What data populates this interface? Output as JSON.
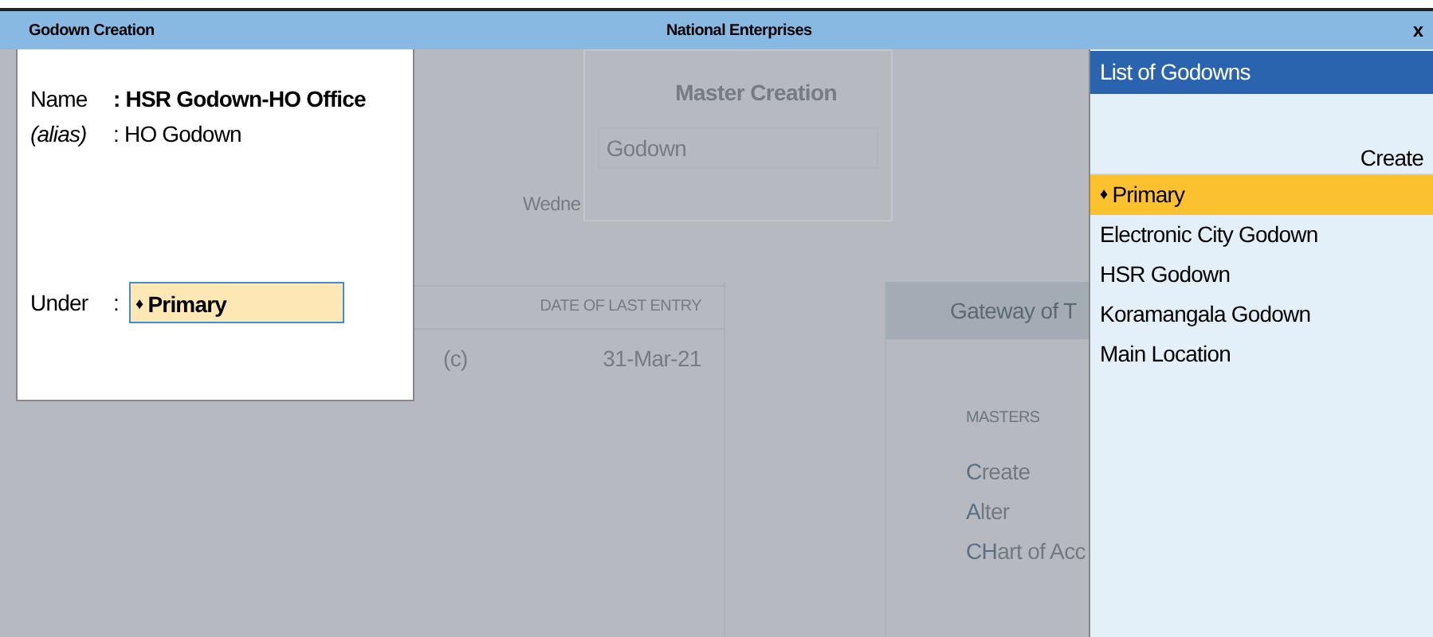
{
  "window": {
    "title": "Godown Creation",
    "company": "National Enterprises",
    "close": "x"
  },
  "form": {
    "separator": ":",
    "fields": [
      {
        "kind": "name",
        "label": "Name",
        "value": "HSR Godown-HO Office"
      },
      {
        "kind": "alias",
        "label": "(alias)",
        "value": "HO Godown"
      }
    ],
    "under": {
      "label": "Under",
      "marker": "♦",
      "value": "Primary"
    }
  },
  "background": {
    "master_creation": {
      "title": "Master Creation",
      "field": "Godown",
      "date_fragment": "Wedne"
    },
    "table": {
      "header": "DATE OF LAST ENTRY",
      "cells": [
        "(c)",
        "31-Mar-21"
      ]
    },
    "gateway": {
      "title": "Gateway of T",
      "section": "MASTERS",
      "items": [
        {
          "hotkey": "C",
          "rest": "reate"
        },
        {
          "hotkey": "A",
          "rest": "lter"
        },
        {
          "hotkey": "CH",
          "rest": "art of Acc"
        }
      ]
    }
  },
  "list": {
    "title": "List of Godowns",
    "action": "Create",
    "items": [
      {
        "label": "Primary",
        "marker": "♦",
        "selected": true
      },
      {
        "label": "Electronic City Godown",
        "selected": false
      },
      {
        "label": "HSR Godown",
        "selected": false
      },
      {
        "label": "Koramangala Godown",
        "selected": false
      },
      {
        "label": "Main Location",
        "selected": false
      }
    ]
  }
}
